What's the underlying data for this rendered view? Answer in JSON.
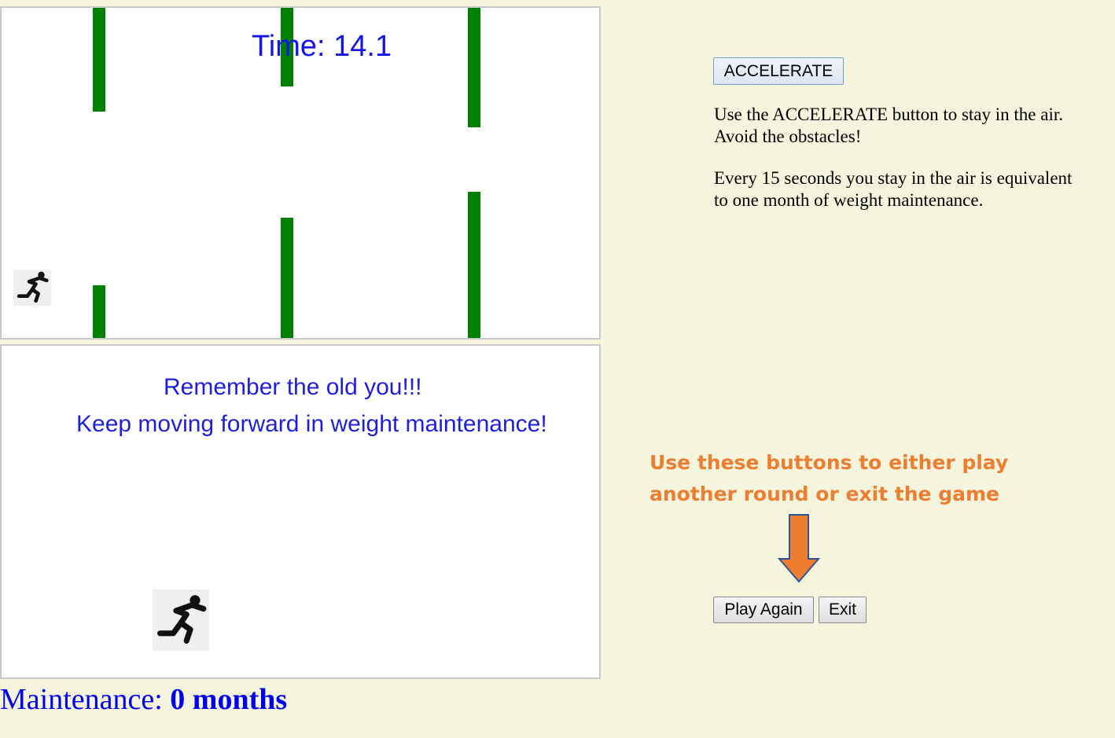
{
  "game": {
    "timer_text": "Time: 14.1",
    "obstacle_color": "#008000",
    "player_icon": "running-man-icon"
  },
  "message_panel": {
    "line1": "Remember the old you!!!",
    "line2": "Keep moving forward in weight maintenance!",
    "icon": "running-man-icon"
  },
  "status": {
    "label": "Maintenance: ",
    "value": "0 months"
  },
  "controls": {
    "accelerate_label": "ACCELERATE",
    "play_again_label": "Play Again",
    "exit_label": "Exit"
  },
  "instructions": {
    "paragraph1": "Use the ACCELERATE button to stay in the air. Avoid the obstacles!",
    "paragraph2": "Every 15 seconds you stay in the air is equivalent to one month of weight maintenance."
  },
  "callout": {
    "line1": "Use these buttons to either play",
    "line2": "another round or exit the game",
    "color": "#ed7d31",
    "arrow_icon": "down-arrow-icon"
  }
}
